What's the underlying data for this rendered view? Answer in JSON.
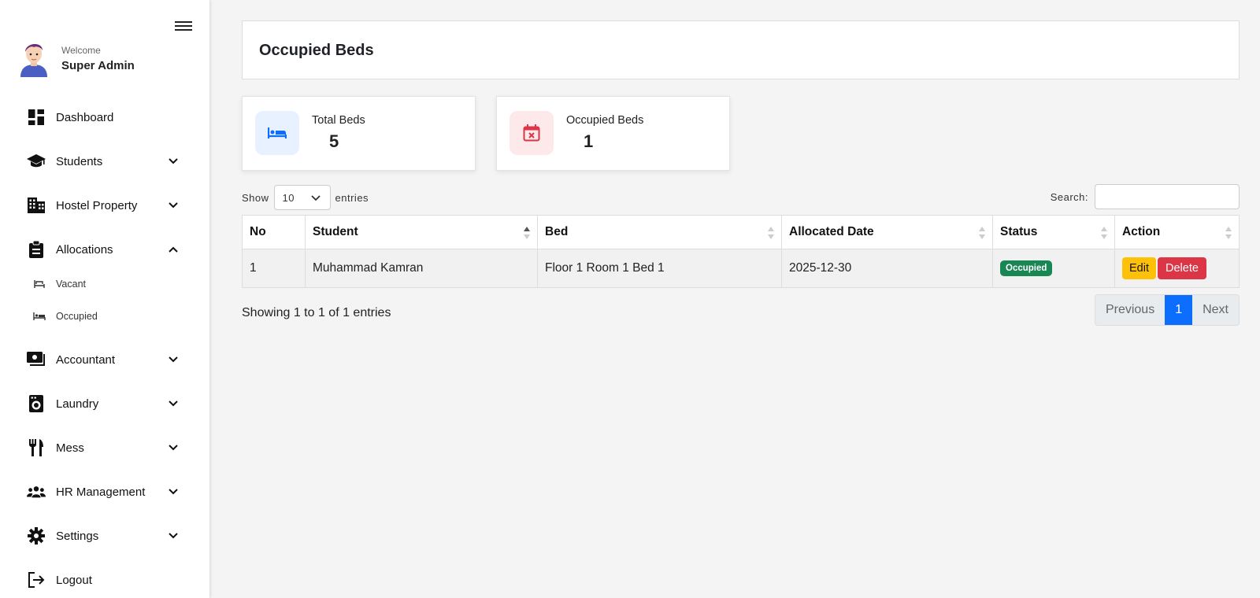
{
  "sidebar": {
    "welcome": "Welcome",
    "user_name": "Super Admin",
    "items": [
      {
        "label": "Dashboard",
        "icon": "dashboard-icon"
      },
      {
        "label": "Students",
        "icon": "graduation-cap-icon"
      },
      {
        "label": "Hostel Property",
        "icon": "building-icon"
      },
      {
        "label": "Allocations",
        "icon": "clipboard-icon"
      },
      {
        "label": "Accountant",
        "icon": "money-icon"
      },
      {
        "label": "Laundry",
        "icon": "washing-machine-icon"
      },
      {
        "label": "Mess",
        "icon": "utensils-icon"
      },
      {
        "label": "HR Management",
        "icon": "users-icon"
      },
      {
        "label": "Settings",
        "icon": "gear-icon"
      },
      {
        "label": "Logout",
        "icon": "logout-icon"
      }
    ],
    "subitems": [
      {
        "label": "Vacant",
        "icon": "bed-empty-icon"
      },
      {
        "label": "Occupied",
        "icon": "bed-occupied-icon"
      }
    ]
  },
  "page": {
    "title": "Occupied Beds"
  },
  "stats": [
    {
      "label": "Total Beds",
      "value": "5",
      "icon": "bed-icon",
      "color": "#0d6efd",
      "bg": "#e8f1ff"
    },
    {
      "label": "Occupied Beds",
      "value": "1",
      "icon": "calendar-x-icon",
      "color": "#dc3545",
      "bg": "#fde8ea"
    }
  ],
  "table_controls": {
    "show_label": "Show",
    "entries_value": "10",
    "entries_label": "entries",
    "search_label": "Search:"
  },
  "table": {
    "headers": [
      "No",
      "Student",
      "Bed",
      "Allocated Date",
      "Status",
      "Action"
    ],
    "rows": [
      {
        "no": "1",
        "student": "Muhammad Kamran",
        "bed": "Floor 1 Room 1 Bed 1",
        "date": "2025-12-30",
        "status": "Occupied"
      }
    ],
    "edit_label": "Edit",
    "delete_label": "Delete"
  },
  "footer": {
    "info": "Showing 1 to 1 of 1 entries",
    "previous": "Previous",
    "page": "1",
    "next": "Next"
  },
  "colors": {
    "primary": "#0d6efd",
    "success": "#198754",
    "warning": "#ffc107",
    "danger": "#dc3545"
  }
}
